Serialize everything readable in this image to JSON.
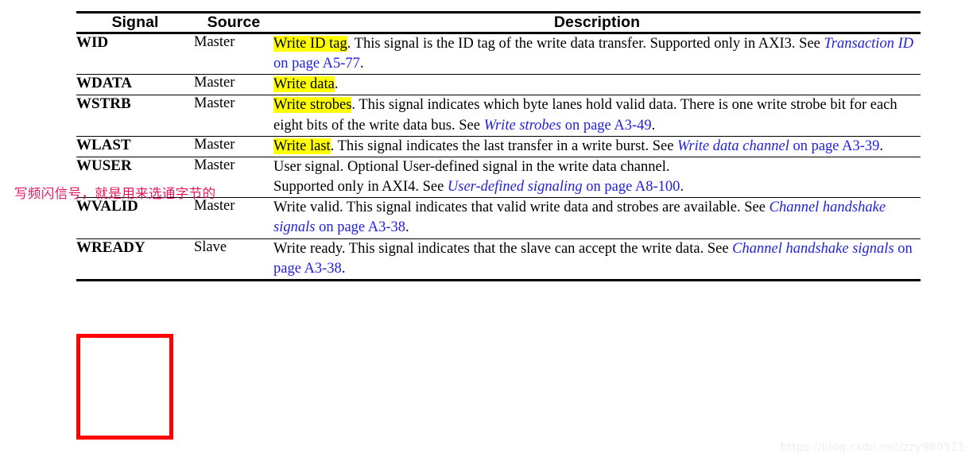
{
  "table": {
    "headers": [
      "Signal",
      "Source",
      "Description"
    ],
    "rows": [
      {
        "signal": "WID",
        "source": "Master",
        "desc_parts": [
          {
            "t": "Write ID tag",
            "s": "hl"
          },
          {
            "t": ". This signal is the ID tag of the write data transfer. Supported only in AXI3. See ",
            "s": "plain"
          },
          {
            "t": "Transaction ID",
            "s": "lnk-title"
          },
          {
            "t": " on page A5-77",
            "s": "lnk"
          },
          {
            "t": ".",
            "s": "plain"
          }
        ]
      },
      {
        "signal": "WDATA",
        "source": "Master",
        "desc_parts": [
          {
            "t": "Write data",
            "s": "hl"
          },
          {
            "t": ".",
            "s": "plain"
          }
        ]
      },
      {
        "signal": "WSTRB",
        "source": "Master",
        "desc_parts": [
          {
            "t": "Write strobes",
            "s": "hl"
          },
          {
            "t": ". This signal indicates which byte lanes hold valid data. There is one write strobe bit for each eight bits of the write data bus. See ",
            "s": "plain"
          },
          {
            "t": "Write strobes",
            "s": "lnk-title"
          },
          {
            "t": " on page A3-49",
            "s": "lnk"
          },
          {
            "t": ".",
            "s": "plain"
          }
        ]
      },
      {
        "signal": "WLAST",
        "source": "Master",
        "desc_parts": [
          {
            "t": "Write last",
            "s": "hl"
          },
          {
            "t": ". This signal indicates the last transfer in a write burst. See ",
            "s": "plain"
          },
          {
            "t": "Write data channel",
            "s": "lnk-title"
          },
          {
            "t": " on page A3-39",
            "s": "lnk"
          },
          {
            "t": ".",
            "s": "plain"
          }
        ]
      },
      {
        "signal": "WUSER",
        "source": "Master",
        "desc_parts": [
          {
            "t": "User signal. Optional User-defined signal in the write data channel.",
            "s": "plain"
          },
          {
            "t": "\n",
            "s": "break"
          },
          {
            "t": "Supported only in AXI4. See ",
            "s": "plain"
          },
          {
            "t": "User-defined signaling",
            "s": "lnk-title"
          },
          {
            "t": " on page A8-100",
            "s": "lnk"
          },
          {
            "t": ".",
            "s": "plain"
          }
        ]
      },
      {
        "signal": "WVALID",
        "source": "Master",
        "desc_parts": [
          {
            "t": "Write valid. This signal indicates that valid write data and strobes are available. See ",
            "s": "plain"
          },
          {
            "t": "Channel handshake signals",
            "s": "lnk-title"
          },
          {
            "t": " on page A3-38",
            "s": "lnk"
          },
          {
            "t": ".",
            "s": "plain"
          }
        ]
      },
      {
        "signal": "WREADY",
        "source": "Slave",
        "desc_parts": [
          {
            "t": "Write ready. This signal indicates that the slave can accept the write data. See ",
            "s": "plain"
          },
          {
            "t": "Channel handshake signals",
            "s": "lnk-title"
          },
          {
            "t": " on page A3-38",
            "s": "lnk"
          },
          {
            "t": ".",
            "s": "plain"
          }
        ]
      }
    ]
  },
  "annotations": {
    "chinese_note": "写频闪信号，就是用来选通字节的",
    "note_color": "#e8175d",
    "highlight_color": "#ffff00",
    "link_color": "#2222dd",
    "box_color": "#ff0000",
    "boxed_signals": [
      "WVALID",
      "WREADY"
    ]
  },
  "watermark": {
    "text": "https://blog.csdn.net/zzy980511"
  }
}
